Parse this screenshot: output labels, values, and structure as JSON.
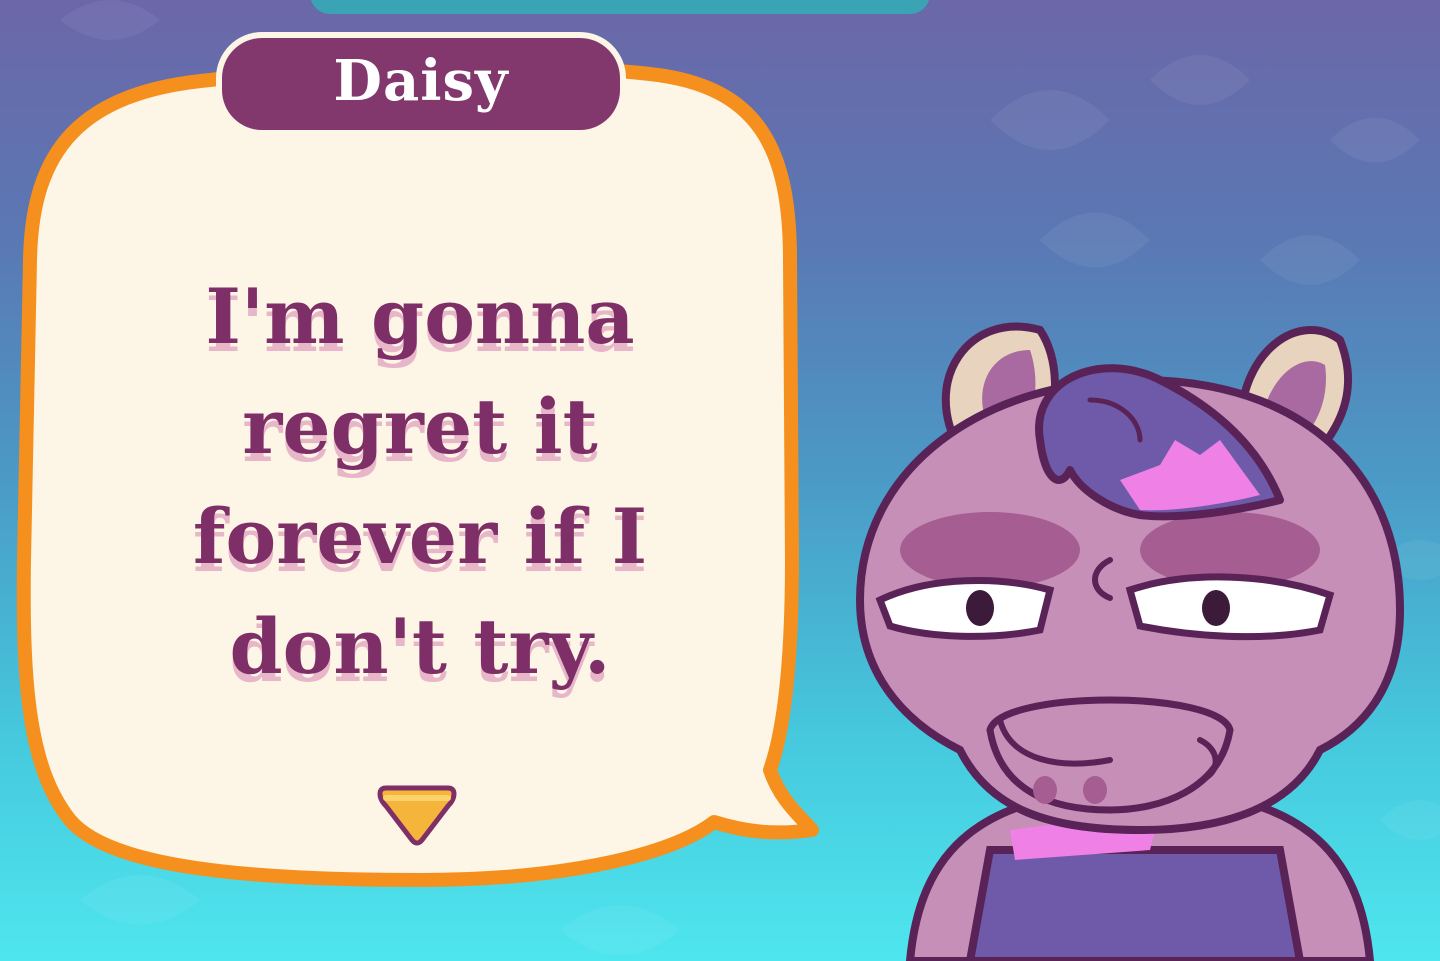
{
  "dialogue": {
    "speaker_name": "Daisy",
    "text": "I'm gonna\nregret it\nforever if I\ndon't try."
  },
  "colors": {
    "bubble_fill": "#fdf5e6",
    "bubble_border": "#f5901e",
    "name_tag": "#82376d",
    "dialogue_text": "#7e2f67",
    "arrow": "#f5b43a"
  },
  "icons": {
    "advance": "chevron-down-icon"
  }
}
